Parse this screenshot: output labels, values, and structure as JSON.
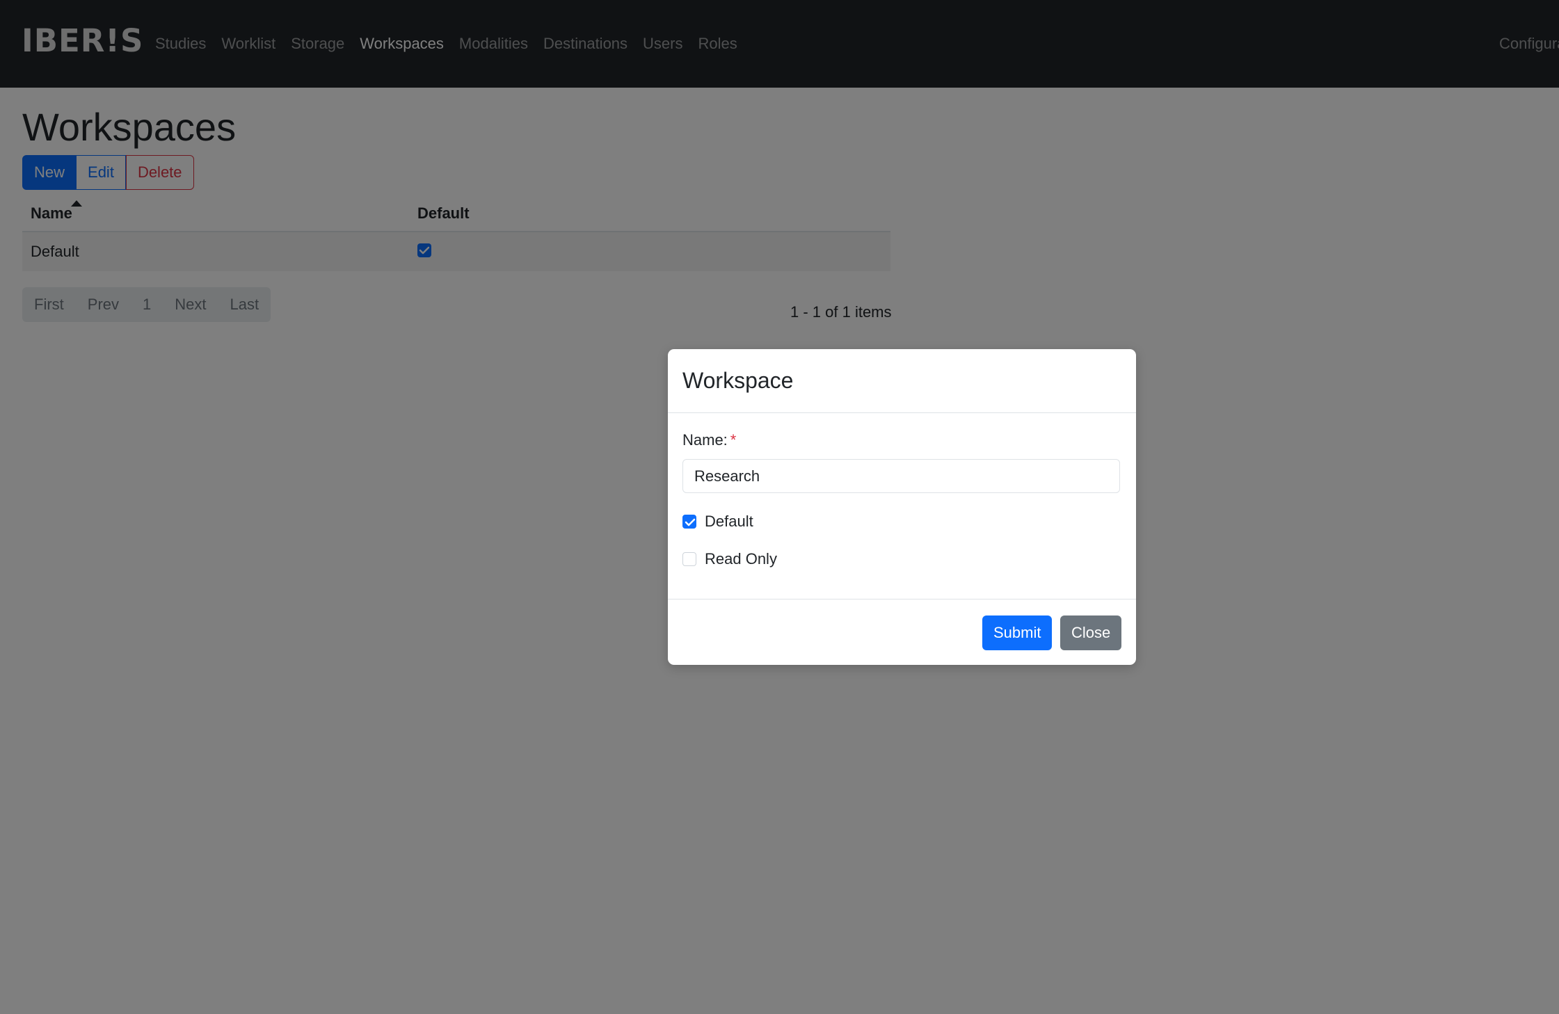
{
  "navbar": {
    "brand": "IBER!S",
    "links": [
      "Studies",
      "Worklist",
      "Storage",
      "Workspaces",
      "Modalities",
      "Destinations",
      "Users",
      "Roles"
    ],
    "active": "Workspaces",
    "right_link": "Configura"
  },
  "page": {
    "title": "Workspaces",
    "toolbar": {
      "new_label": "New",
      "edit_label": "Edit",
      "delete_label": "Delete"
    }
  },
  "grid": {
    "columns": [
      "Name",
      "Default"
    ],
    "sort": {
      "column": "Name",
      "direction": "ascending"
    },
    "rows": [
      {
        "name": "Default",
        "default": true
      }
    ]
  },
  "pager": {
    "first": "First",
    "prev": "Prev",
    "page": "1",
    "next": "Next",
    "last": "Last",
    "info": "1 - 1 of 1 items"
  },
  "modal": {
    "title": "Workspace",
    "name_label": "Name:",
    "required_marker": "*",
    "name_value": "Research",
    "default_label": "Default",
    "default_checked": true,
    "read_only_label": "Read Only",
    "read_only_checked": false,
    "submit_label": "Submit",
    "close_label": "Close"
  },
  "colors": {
    "navbar": "#212529",
    "primary": "#0d6efd",
    "danger": "#dc3545",
    "secondary": "#6c757d"
  }
}
